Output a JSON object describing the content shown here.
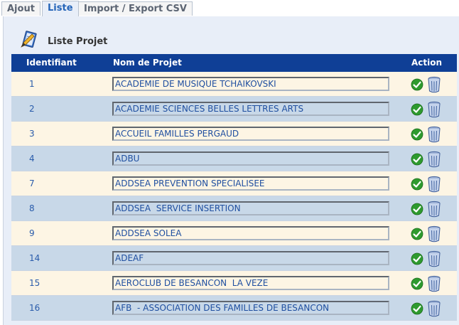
{
  "tabs": [
    {
      "label": "Ajout",
      "active": false
    },
    {
      "label": "Liste",
      "active": true
    },
    {
      "label": "Import / Export CSV",
      "active": false
    }
  ],
  "panel": {
    "title": "Liste Projet",
    "icon": "edit-document-icon"
  },
  "table": {
    "headers": {
      "id": "Identifiant",
      "name": "Nom de Projet",
      "action": "Action"
    },
    "rows": [
      {
        "id": "1",
        "name": "ACADEMIE DE MUSIQUE TCHAIKOVSKI"
      },
      {
        "id": "2",
        "name": "ACADEMIE SCIENCES BELLES LETTRES ARTS"
      },
      {
        "id": "3",
        "name": "ACCUEIL FAMILLES PERGAUD"
      },
      {
        "id": "4",
        "name": "ADBU"
      },
      {
        "id": "7",
        "name": "ADDSEA PREVENTION SPECIALISEE"
      },
      {
        "id": "8",
        "name": "ADDSEA  SERVICE INSERTION"
      },
      {
        "id": "9",
        "name": "ADDSEA SOLEA"
      },
      {
        "id": "14",
        "name": "ADEAF"
      },
      {
        "id": "15",
        "name": "AEROCLUB DE BESANCON  LA VEZE"
      },
      {
        "id": "16",
        "name": "AFB  - ASSOCIATION DES FAMILLES DE BESANCON"
      }
    ],
    "action_icons": [
      "check-icon",
      "trash-can-icon"
    ]
  },
  "colors": {
    "header_bg": "#0f3f96",
    "row_odd": "#fdf5e4",
    "row_even": "#c8d8e8",
    "accent": "#2464b8",
    "ok_green": "#2e9a2e"
  }
}
